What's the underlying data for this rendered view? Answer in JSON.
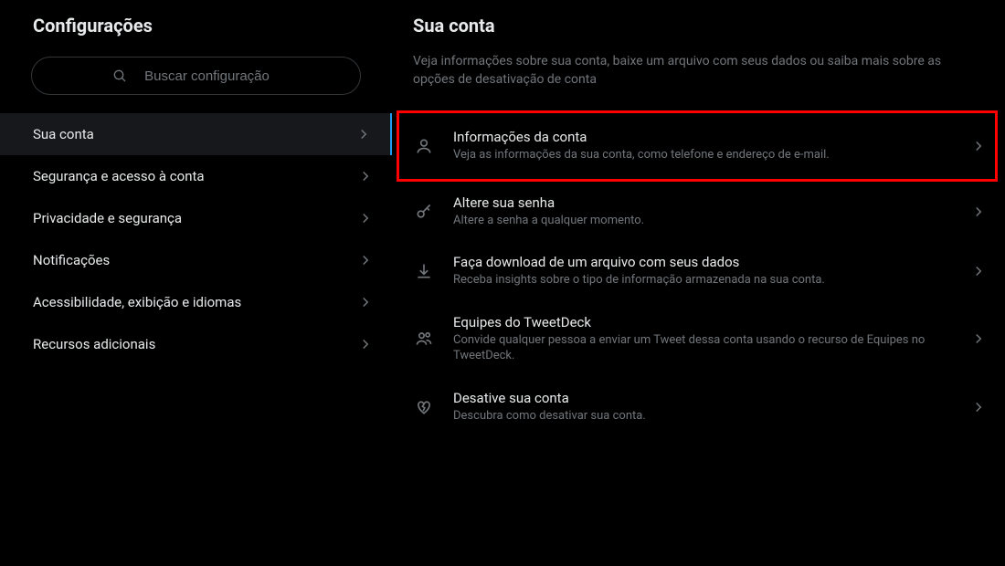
{
  "sidebar": {
    "title": "Configurações",
    "search_placeholder": "Buscar configuração",
    "items": [
      {
        "label": "Sua conta",
        "active": true
      },
      {
        "label": "Segurança e acesso à conta",
        "active": false
      },
      {
        "label": "Privacidade e segurança",
        "active": false
      },
      {
        "label": "Notificações",
        "active": false
      },
      {
        "label": "Acessibilidade, exibição e idiomas",
        "active": false
      },
      {
        "label": "Recursos adicionais",
        "active": false
      }
    ]
  },
  "main": {
    "title": "Sua conta",
    "description": "Veja informações sobre sua conta, baixe um arquivo com seus dados ou saiba mais sobre as opções de desativação de conta",
    "options": [
      {
        "icon": "user-icon",
        "title": "Informações da conta",
        "sub": "Veja as informações da sua conta, como telefone e endereço de e-mail.",
        "highlighted": true
      },
      {
        "icon": "key-icon",
        "title": "Altere sua senha",
        "sub": "Altere a senha a qualquer momento.",
        "highlighted": false
      },
      {
        "icon": "download-icon",
        "title": "Faça download de um arquivo com seus dados",
        "sub": "Receba insights sobre o tipo de informação armazenada na sua conta.",
        "highlighted": false
      },
      {
        "icon": "people-icon",
        "title": "Equipes do TweetDeck",
        "sub": "Convide qualquer pessoa a enviar um Tweet dessa conta usando o recurso de Equipes no TweetDeck.",
        "highlighted": false
      },
      {
        "icon": "heart-broken-icon",
        "title": "Desative sua conta",
        "sub": "Descubra como desativar sua conta.",
        "highlighted": false
      }
    ]
  }
}
